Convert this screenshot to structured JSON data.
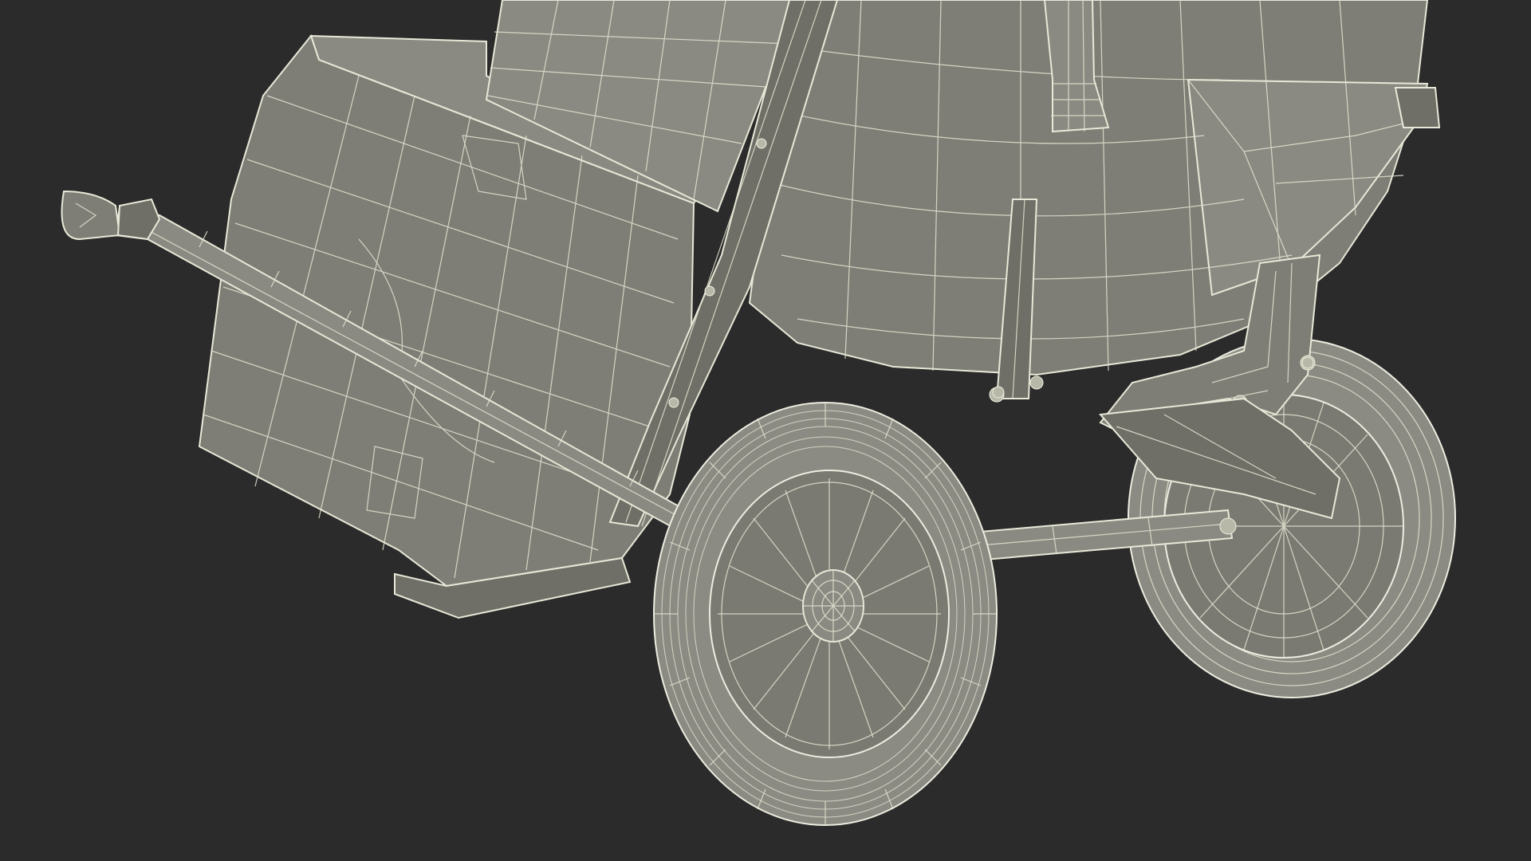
{
  "scene": {
    "subject": "wireframe-render",
    "background_color": "#2b2b2b",
    "mesh_fill_color": "#7e7e76",
    "wire_color": "#e4e4d2"
  }
}
